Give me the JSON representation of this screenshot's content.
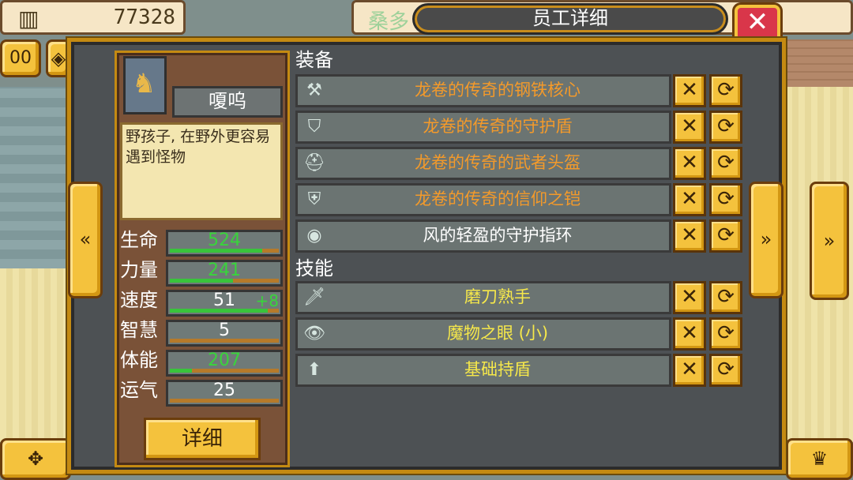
{
  "top": {
    "money": "77328",
    "location": "桑多",
    "title": "员工详细",
    "close": "✕"
  },
  "hud": {
    "pause": "00",
    "left_arrow": "«",
    "right_arrow": "»",
    "dpad": "✥",
    "crown": "♛"
  },
  "employee": {
    "name": "嗄呜",
    "description": "野孩子, 在野外更容易遇到怪物",
    "detail_button": "详细",
    "stats": [
      {
        "label": "生命",
        "value": "524",
        "value_color": "#39d43b",
        "fill": 0.85,
        "bonus": ""
      },
      {
        "label": "力量",
        "value": "241",
        "value_color": "#39d43b",
        "fill": 0.58,
        "bonus": ""
      },
      {
        "label": "速度",
        "value": "51",
        "value_color": "#ffffff",
        "fill": 0.9,
        "bonus": "+8"
      },
      {
        "label": "智慧",
        "value": "5",
        "value_color": "#ffffff",
        "fill": 0.0,
        "bonus": ""
      },
      {
        "label": "体能",
        "value": "207",
        "value_color": "#39d43b",
        "fill": 0.2,
        "bonus": ""
      },
      {
        "label": "运气",
        "value": "25",
        "value_color": "#ffffff",
        "fill": 0.0,
        "bonus": ""
      }
    ]
  },
  "equipment": {
    "label": "装备",
    "items": [
      {
        "name": "龙卷的传奇的钢铁核心",
        "color": "#f49a2a",
        "icon": "⚒"
      },
      {
        "name": "龙卷的传奇的守护盾",
        "color": "#f49a2a",
        "icon": "⛉"
      },
      {
        "name": "龙卷的传奇的武者头盔",
        "color": "#f49a2a",
        "icon": "⛑"
      },
      {
        "name": "龙卷的传奇的信仰之铠",
        "color": "#f49a2a",
        "icon": "⛨"
      },
      {
        "name": "风的轻盈的守护指环",
        "color": "#ffffff",
        "icon": "◉"
      }
    ]
  },
  "skills": {
    "label": "技能",
    "items": [
      {
        "name": "磨刀熟手",
        "color": "#f6e84a",
        "icon": "🗡"
      },
      {
        "name": "魔物之眼 (小)",
        "color": "#f6e84a",
        "icon": "👁"
      },
      {
        "name": "基础持盾",
        "color": "#f6e84a",
        "icon": "⬆"
      }
    ]
  },
  "row_buttons": {
    "remove": "✕",
    "swap": "⟳"
  }
}
